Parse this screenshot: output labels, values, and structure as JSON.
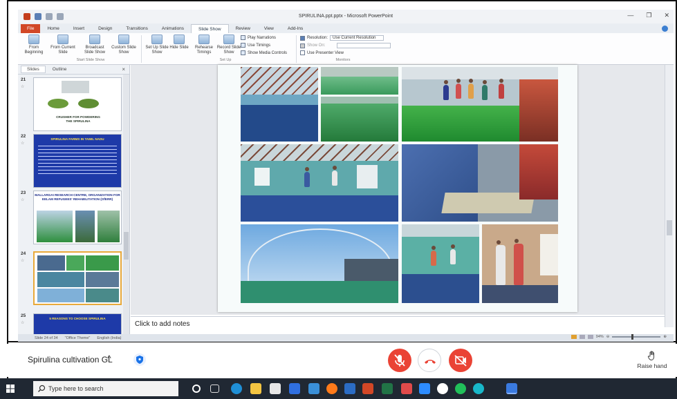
{
  "powerpoint": {
    "doc_title": "SPIRULINA.ppt.pptx - Microsoft PowerPoint",
    "window_controls": {
      "minimize": "—",
      "restore": "❐",
      "close": "✕"
    },
    "tabs": [
      {
        "label": "File"
      },
      {
        "label": "Home"
      },
      {
        "label": "Insert"
      },
      {
        "label": "Design"
      },
      {
        "label": "Transitions"
      },
      {
        "label": "Animations"
      },
      {
        "label": "Slide Show"
      },
      {
        "label": "Review"
      },
      {
        "label": "View"
      },
      {
        "label": "Add-Ins"
      }
    ],
    "ribbon": {
      "from_beginning": "From Beginning",
      "from_current": "From Current Slide",
      "broadcast": "Broadcast Slide Show",
      "custom_show": "Custom Slide Show",
      "start_group": "Start Slide Show",
      "setup_show": "Set Up Slide Show",
      "hide_slide": "Hide Slide",
      "rehearse": "Rehearse Timings",
      "record": "Record Slide Show",
      "play_narrations": "Play Narrations",
      "use_timings": "Use Timings",
      "show_media_controls": "Show Media Controls",
      "setup_group": "Set Up",
      "resolution_label": "Resolution:",
      "resolution_value": "Use Current Resolution",
      "show_on_label": "Show On:",
      "presenter_view": "Use Presenter View",
      "monitors_group": "Monitors"
    },
    "left_pane": {
      "tab_slides": "Slides",
      "tab_outline": "Outline",
      "close": "×",
      "thumbnails": [
        {
          "number": "21",
          "caption": "CRUSHER FOR POWDERING THE SPIRULINA"
        },
        {
          "number": "22",
          "caption": "SPIRULINA FARMS IN TAMIL NADU"
        },
        {
          "number": "23",
          "caption": "MALLARGAI RESEARCH CENTRE, ORGANIZATION FOR EELAM REFUGEES' REHABILITATION (OfERR)"
        },
        {
          "number": "24",
          "caption": ""
        },
        {
          "number": "25",
          "caption": "5 REASONS TO CHOOSE SPIRULINA"
        }
      ]
    },
    "notes_placeholder": "Click to add notes",
    "status": {
      "slide_pos": "Slide 24 of 34",
      "theme": "\"Office Theme\"",
      "language": "English (India)",
      "zoom": "94%"
    }
  },
  "meet": {
    "meeting_name": "Spirulina cultivation GL",
    "chevron": "^",
    "raise_hand": "Raise hand"
  },
  "taskbar": {
    "search_placeholder": "Type here to search"
  },
  "colors": {
    "accent_red": "#ea4335",
    "ribbon_file": "#d24726",
    "taskbar": "#202833",
    "pool_green": "#3aa04a"
  }
}
